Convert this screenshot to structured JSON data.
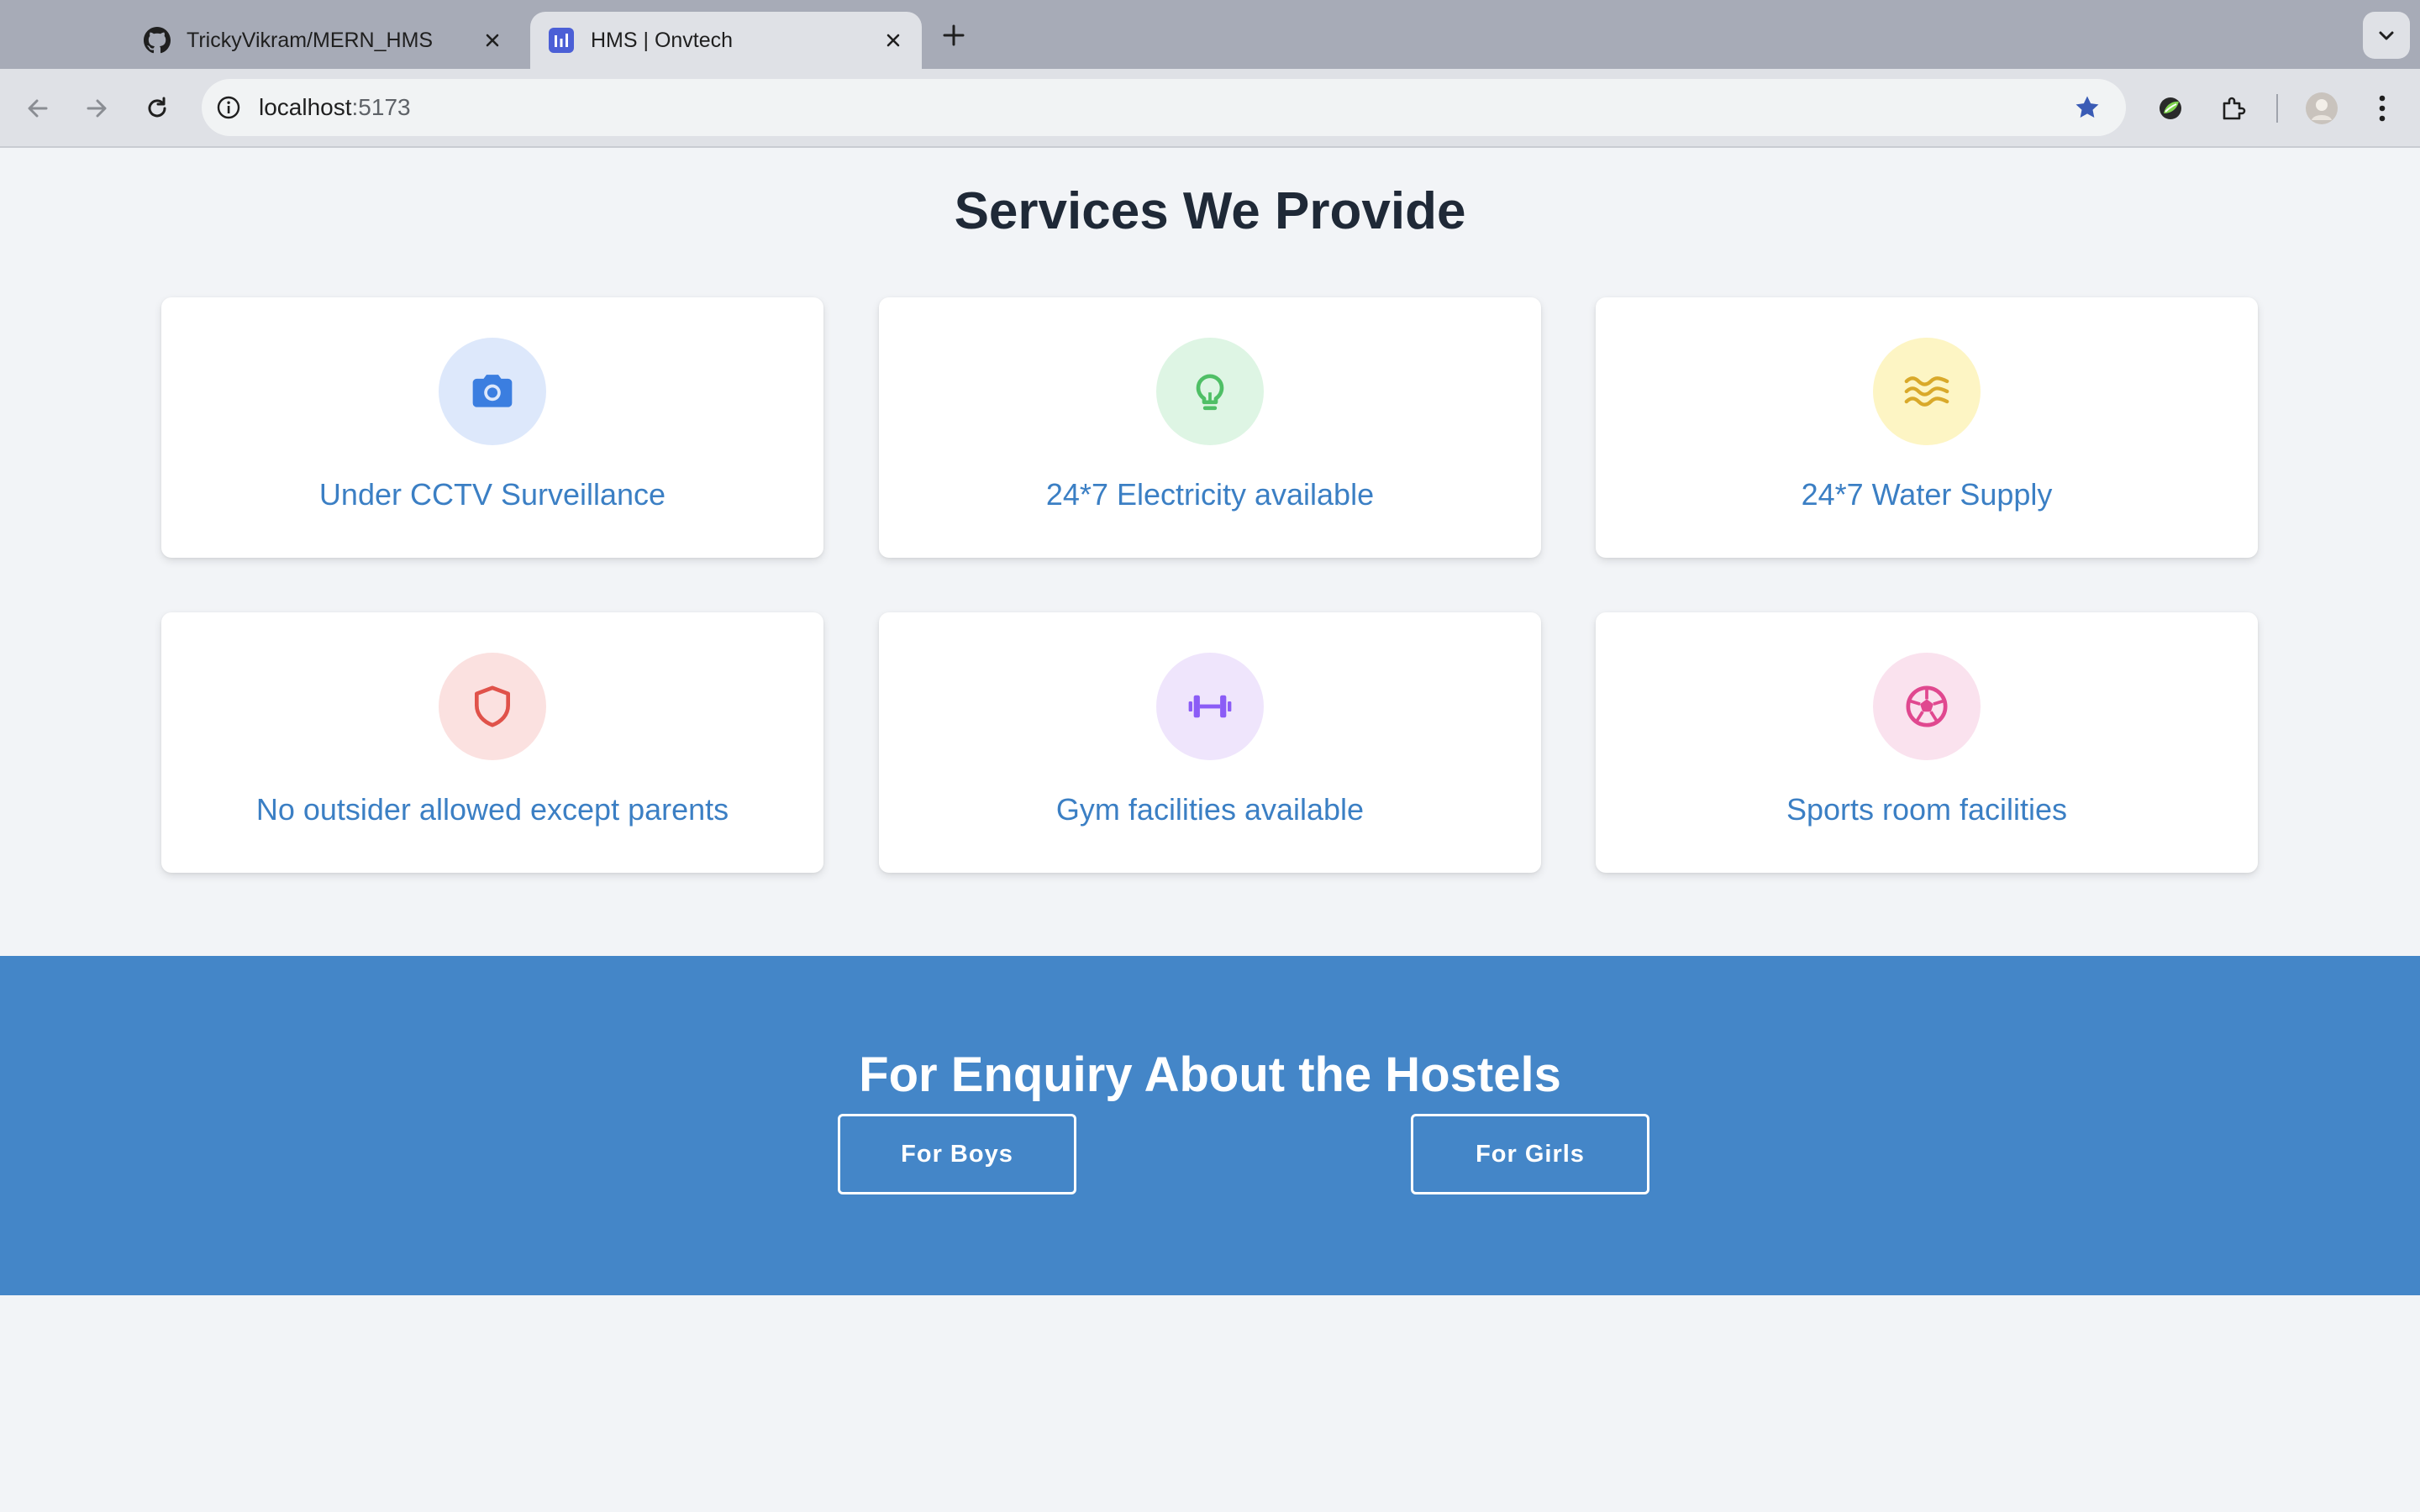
{
  "browser": {
    "tabs": [
      {
        "title": "TrickyVikram/MERN_HMS",
        "favicon": "github-icon",
        "active": false
      },
      {
        "title": "HMS | Onvtech",
        "favicon": "hms-app-icon",
        "active": true
      }
    ],
    "url_host": "localhost",
    "url_port": ":5173"
  },
  "services": {
    "title": "Services We Provide",
    "items": [
      {
        "label": "Under CCTV Surveillance",
        "icon": "camera-icon",
        "icon_color": "#3b7ee0",
        "bg_color": "#dde8fb"
      },
      {
        "label": "24*7 Electricity available",
        "icon": "lightbulb-icon",
        "icon_color": "#4fbf66",
        "bg_color": "#def5e4"
      },
      {
        "label": "24*7 Water Supply",
        "icon": "waves-icon",
        "icon_color": "#d9a92a",
        "bg_color": "#fdf5c4"
      },
      {
        "label": "No outsider allowed except parents",
        "icon": "shield-icon",
        "icon_color": "#e0524a",
        "bg_color": "#fbe1e0"
      },
      {
        "label": "Gym facilities available",
        "icon": "dumbbell-icon",
        "icon_color": "#8b5cf6",
        "bg_color": "#efe5fc"
      },
      {
        "label": "Sports room facilities",
        "icon": "soccer-ball-icon",
        "icon_color": "#e0488f",
        "bg_color": "#fae2ee"
      }
    ]
  },
  "enquiry": {
    "title": "For Enquiry About the Hostels",
    "boys_label": "For Boys",
    "girls_label": "For Girls",
    "bg_color": "#4486c8"
  }
}
